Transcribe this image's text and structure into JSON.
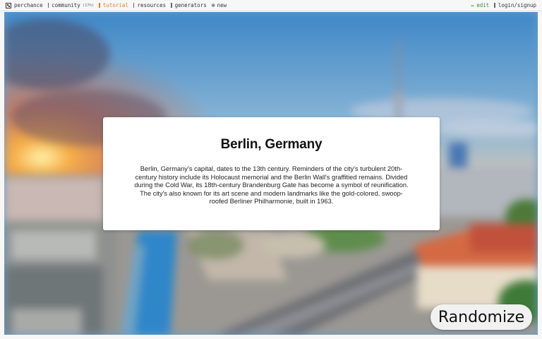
{
  "nav": {
    "left": [
      {
        "label": "perchance",
        "icon": "perchance-logo-icon"
      },
      {
        "label": "community",
        "badge": "(17h)",
        "icon": "bar-icon"
      },
      {
        "label": "tutorial",
        "icon": "bar-icon",
        "active": true
      },
      {
        "label": "resources",
        "icon": "bar-icon"
      },
      {
        "label": "generators",
        "icon": "bar-icon"
      },
      {
        "label": "new",
        "icon": "plus-circle-icon"
      }
    ],
    "right": [
      {
        "label": "edit",
        "icon": "pencil-icon"
      },
      {
        "label": "login/signup",
        "icon": "bar-icon"
      }
    ]
  },
  "colors": {
    "active_nav": "#d9822b",
    "edit_nav": "#3a8a3a",
    "card_bg": "#ffffff",
    "button_bg": "#f1f1f1"
  },
  "card": {
    "title": "Berlin, Germany",
    "description": "Berlin, Germany’s capital, dates to the 13th century. Reminders of the city's turbulent 20th-century history include its Holocaust memorial and the Berlin Wall's graffitied remains. Divided during the Cold War, its 18th-century Brandenburg Gate has become a symbol of reunification. The city's also known for its art scene and modern landmarks like the gold-colored, swoop-roofed Berliner Philharmonie, built in 1963."
  },
  "background": {
    "scene": "blurred-berlin-skyline-photo"
  },
  "randomize_label": "Randomize"
}
